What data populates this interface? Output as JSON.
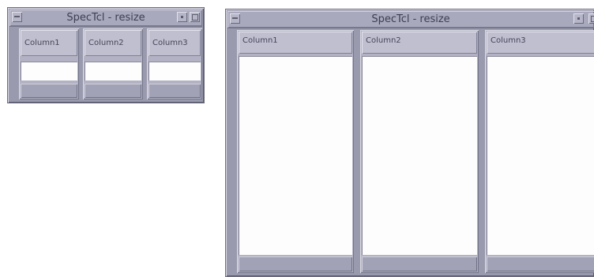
{
  "windows": [
    {
      "title": "SpecTcl - resize",
      "columns": [
        {
          "header": "Column1"
        },
        {
          "header": "Column2"
        },
        {
          "header": "Column3"
        }
      ]
    },
    {
      "title": "SpecTcl - resize",
      "columns": [
        {
          "header": "Column1"
        },
        {
          "header": "Column2"
        },
        {
          "header": "Column3"
        }
      ]
    }
  ]
}
